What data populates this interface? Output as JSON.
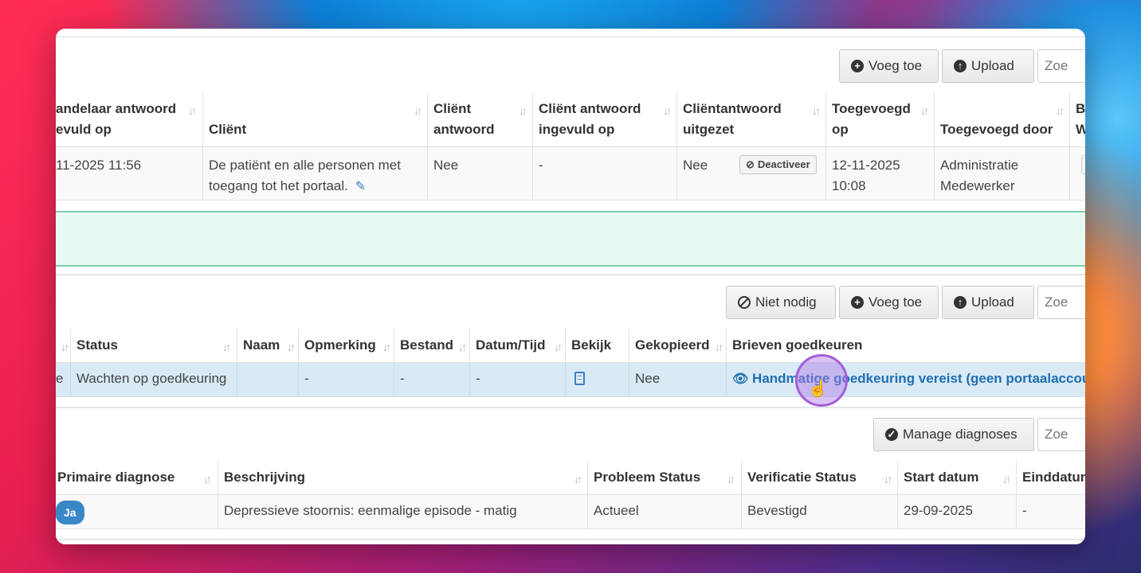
{
  "section1": {
    "toolbar": {
      "add_label": "Voeg toe",
      "upload_label": "Upload",
      "search_placeholder": "Zoe"
    },
    "headers": [
      {
        "line1": "andelaar antwoord",
        "line2": "evuld op"
      },
      {
        "line1": "",
        "line2": "Cliënt"
      },
      {
        "line1": "Cliënt",
        "line2": "antwoord"
      },
      {
        "line1": "Cliënt antwoord",
        "line2": "ingevuld op"
      },
      {
        "line1": "Cliëntantwoord",
        "line2": "uitgezet"
      },
      {
        "line1": "Toegevoegd",
        "line2": "op"
      },
      {
        "line1": "",
        "line2": "Toegevoegd door"
      },
      {
        "line1": "B",
        "line2": "W"
      }
    ],
    "row": {
      "c0": "11-2025 11:56",
      "c1a": "De patiënt en alle personen met",
      "c1b": "toegang tot het portaal.",
      "c2": "Nee",
      "c3": "-",
      "c4": "Nee",
      "deactivate_label": "Deactiveer",
      "c5a": "12-11-2025",
      "c5b": "10:08",
      "c6a": "Administratie",
      "c6b": "Medewerker"
    }
  },
  "section2": {
    "toolbar": {
      "not_needed_label": "Niet nodig",
      "add_label": "Voeg toe",
      "upload_label": "Upload",
      "search_placeholder": "Zoe"
    },
    "headers": [
      "Status",
      "Naam",
      "Opmerking",
      "Bestand",
      "Datum/Tijd",
      "Bekijk",
      "Gekopieerd",
      "Brieven goedkeuren"
    ],
    "row": {
      "c0": "e",
      "status": "Wachten op goedkeuring",
      "opmerking": "-",
      "bestand": "-",
      "datum": "-",
      "gekopieerd": "Nee",
      "approval_link": "Handmatige goedkeuring vereist (geen portaalaccount)"
    }
  },
  "section3": {
    "toolbar": {
      "manage_label": "Manage diagnoses",
      "search_placeholder": "Zoe"
    },
    "headers": [
      "Primaire diagnose",
      "Beschrijving",
      "Probleem Status",
      "Verificatie Status",
      "Start datum",
      "Einddatum"
    ],
    "row": {
      "primary": "Ja",
      "description": "Depressieve stoornis: eenmalige episode - matig",
      "problem_status": "Actueel",
      "verification_status": "Bevestigd",
      "start_date": "29-09-2025",
      "end_date": "-"
    }
  },
  "colors": {
    "accent_link": "#1f6fb2",
    "success_band": "#e6f9f2",
    "selected_row": "#d9eaf5",
    "badge_blue": "#3a87c8"
  }
}
